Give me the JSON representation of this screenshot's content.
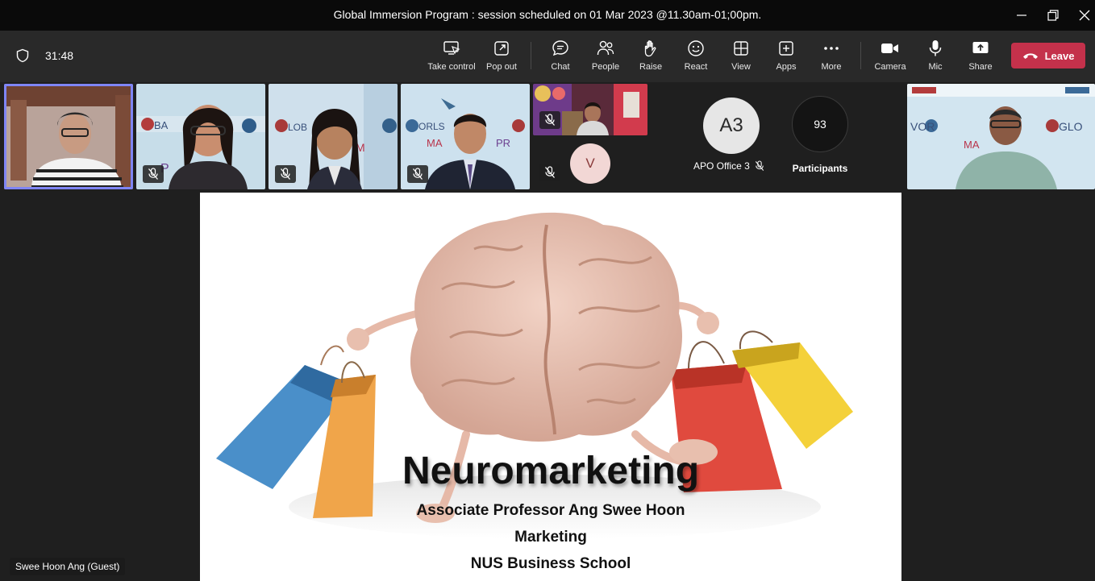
{
  "window": {
    "title": "Global Immersion Program : session scheduled on 01 Mar 2023 @11.30am-01;00pm."
  },
  "toolbar": {
    "timer": "31:48",
    "take_control": "Take control",
    "pop_out": "Pop out",
    "chat": "Chat",
    "people": "People",
    "raise": "Raise",
    "react": "React",
    "view": "View",
    "apps": "Apps",
    "more": "More",
    "camera": "Camera",
    "mic": "Mic",
    "share": "Share",
    "leave": "Leave"
  },
  "participants": {
    "avatar_a3_initials": "A3",
    "avatar_a3_name": "APO Office 3",
    "count": "93",
    "count_label": "Participants",
    "avatar_v_initial": "V"
  },
  "active_speaker": {
    "name": "Swee Hoon Ang (Guest)"
  },
  "slide": {
    "title": "Neuromarketing",
    "line1": "Associate Professor Ang Swee Hoon",
    "line2": "Marketing",
    "line3": "NUS Business School"
  },
  "colors": {
    "leave": "#c4314b",
    "accent": "#7f85f5",
    "toolbar_bg": "#292929",
    "titlebar_bg": "#0a0a0a"
  }
}
